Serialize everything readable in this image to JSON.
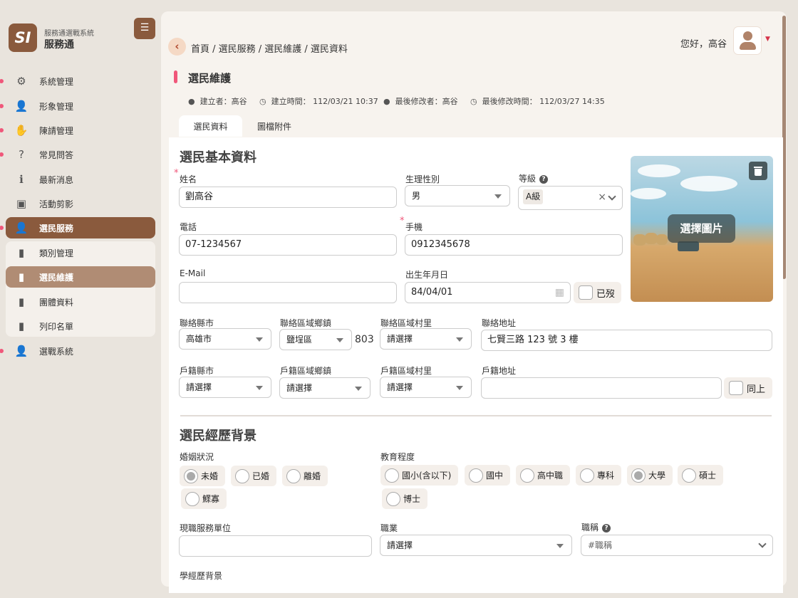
{
  "brand": {
    "logo_text": "SI",
    "subtitle": "服務通選戰系統",
    "title": "服務通"
  },
  "nav": {
    "items": [
      {
        "label": "系統管理",
        "icon": "gear-icon"
      },
      {
        "label": "形象管理",
        "icon": "user-cog-icon"
      },
      {
        "label": "陳請管理",
        "icon": "praying-hands-icon"
      },
      {
        "label": "常見問答",
        "icon": "question-circle-icon"
      },
      {
        "label": "最新消息",
        "icon": "info-circle-icon"
      },
      {
        "label": "活動剪影",
        "icon": "images-icon"
      },
      {
        "label": "選民服務",
        "icon": "user-edit-icon"
      }
    ],
    "sub": [
      {
        "label": "類別管理"
      },
      {
        "label": "選民維護"
      },
      {
        "label": "團體資料"
      },
      {
        "label": "列印名單"
      }
    ],
    "last": {
      "label": "選戰系統",
      "icon": "user-icon"
    }
  },
  "header": {
    "breadcrumb": "首頁 / 選民服務 / 選民維護 / 選民資料",
    "greeting": "您好，高谷"
  },
  "page": {
    "title": "選民維護",
    "creator": "建立者：高谷",
    "created": "建立時間： 112/03/21 10:37",
    "modifier": "最後修改者：高谷",
    "modified": "最後修改時間： 112/03/27 14:35"
  },
  "tabs": [
    {
      "label": "選民資料"
    },
    {
      "label": "圖檔附件"
    }
  ],
  "basic": {
    "heading": "選民基本資料",
    "name_label": "姓名",
    "name_value": "劉高谷",
    "gender_label": "生理性別",
    "gender_value": "男",
    "level_label": "等級",
    "level_value": "A級",
    "phone_label": "電話",
    "phone_value": "07-1234567",
    "mobile_label": "手機",
    "mobile_value": "0912345678",
    "email_label": "E-Mail",
    "email_value": "",
    "birth_label": "出生年月日",
    "birth_value": "84/04/01",
    "deceased_label": "已歿",
    "photo_label": "選擇圖片",
    "contact_city_label": "聯絡縣市",
    "contact_city_value": "高雄市",
    "contact_district_label": "聯絡區域鄉鎮",
    "contact_district_value": "鹽埕區",
    "zip": "803",
    "contact_village_label": "聯絡區域村里",
    "contact_village_value": "請選擇",
    "contact_addr_label": "聯絡地址",
    "contact_addr_value": "七賢三路 123 號 3 樓",
    "reg_city_label": "戶籍縣市",
    "reg_city_value": "請選擇",
    "reg_district_label": "戶籍區域鄉鎮",
    "reg_district_value": "請選擇",
    "reg_village_label": "戶籍區域村里",
    "reg_village_value": "請選擇",
    "reg_addr_label": "戶籍地址",
    "reg_addr_value": "",
    "same_label": "同上"
  },
  "background": {
    "heading": "選民經歷背景",
    "marital_label": "婚姻狀況",
    "marital_options": [
      "未婚",
      "已婚",
      "離婚",
      "鰥寡"
    ],
    "marital_selected": "未婚",
    "edu_label": "教育程度",
    "edu_options": [
      "國小(含以下)",
      "國中",
      "高中職",
      "專科",
      "大學",
      "碩士",
      "博士"
    ],
    "edu_selected": "大學",
    "workplace_label": "現職服務單位",
    "workplace_value": "",
    "job_label": "職業",
    "job_value": "請選擇",
    "jobtitle_label": "職稱",
    "jobtitle_placeholder": "#職稱",
    "history_label": "學經歷背景"
  },
  "colors": {
    "primary": "#8a5a3d",
    "accent": "#f0577a",
    "panel": "#f7f3ee"
  }
}
